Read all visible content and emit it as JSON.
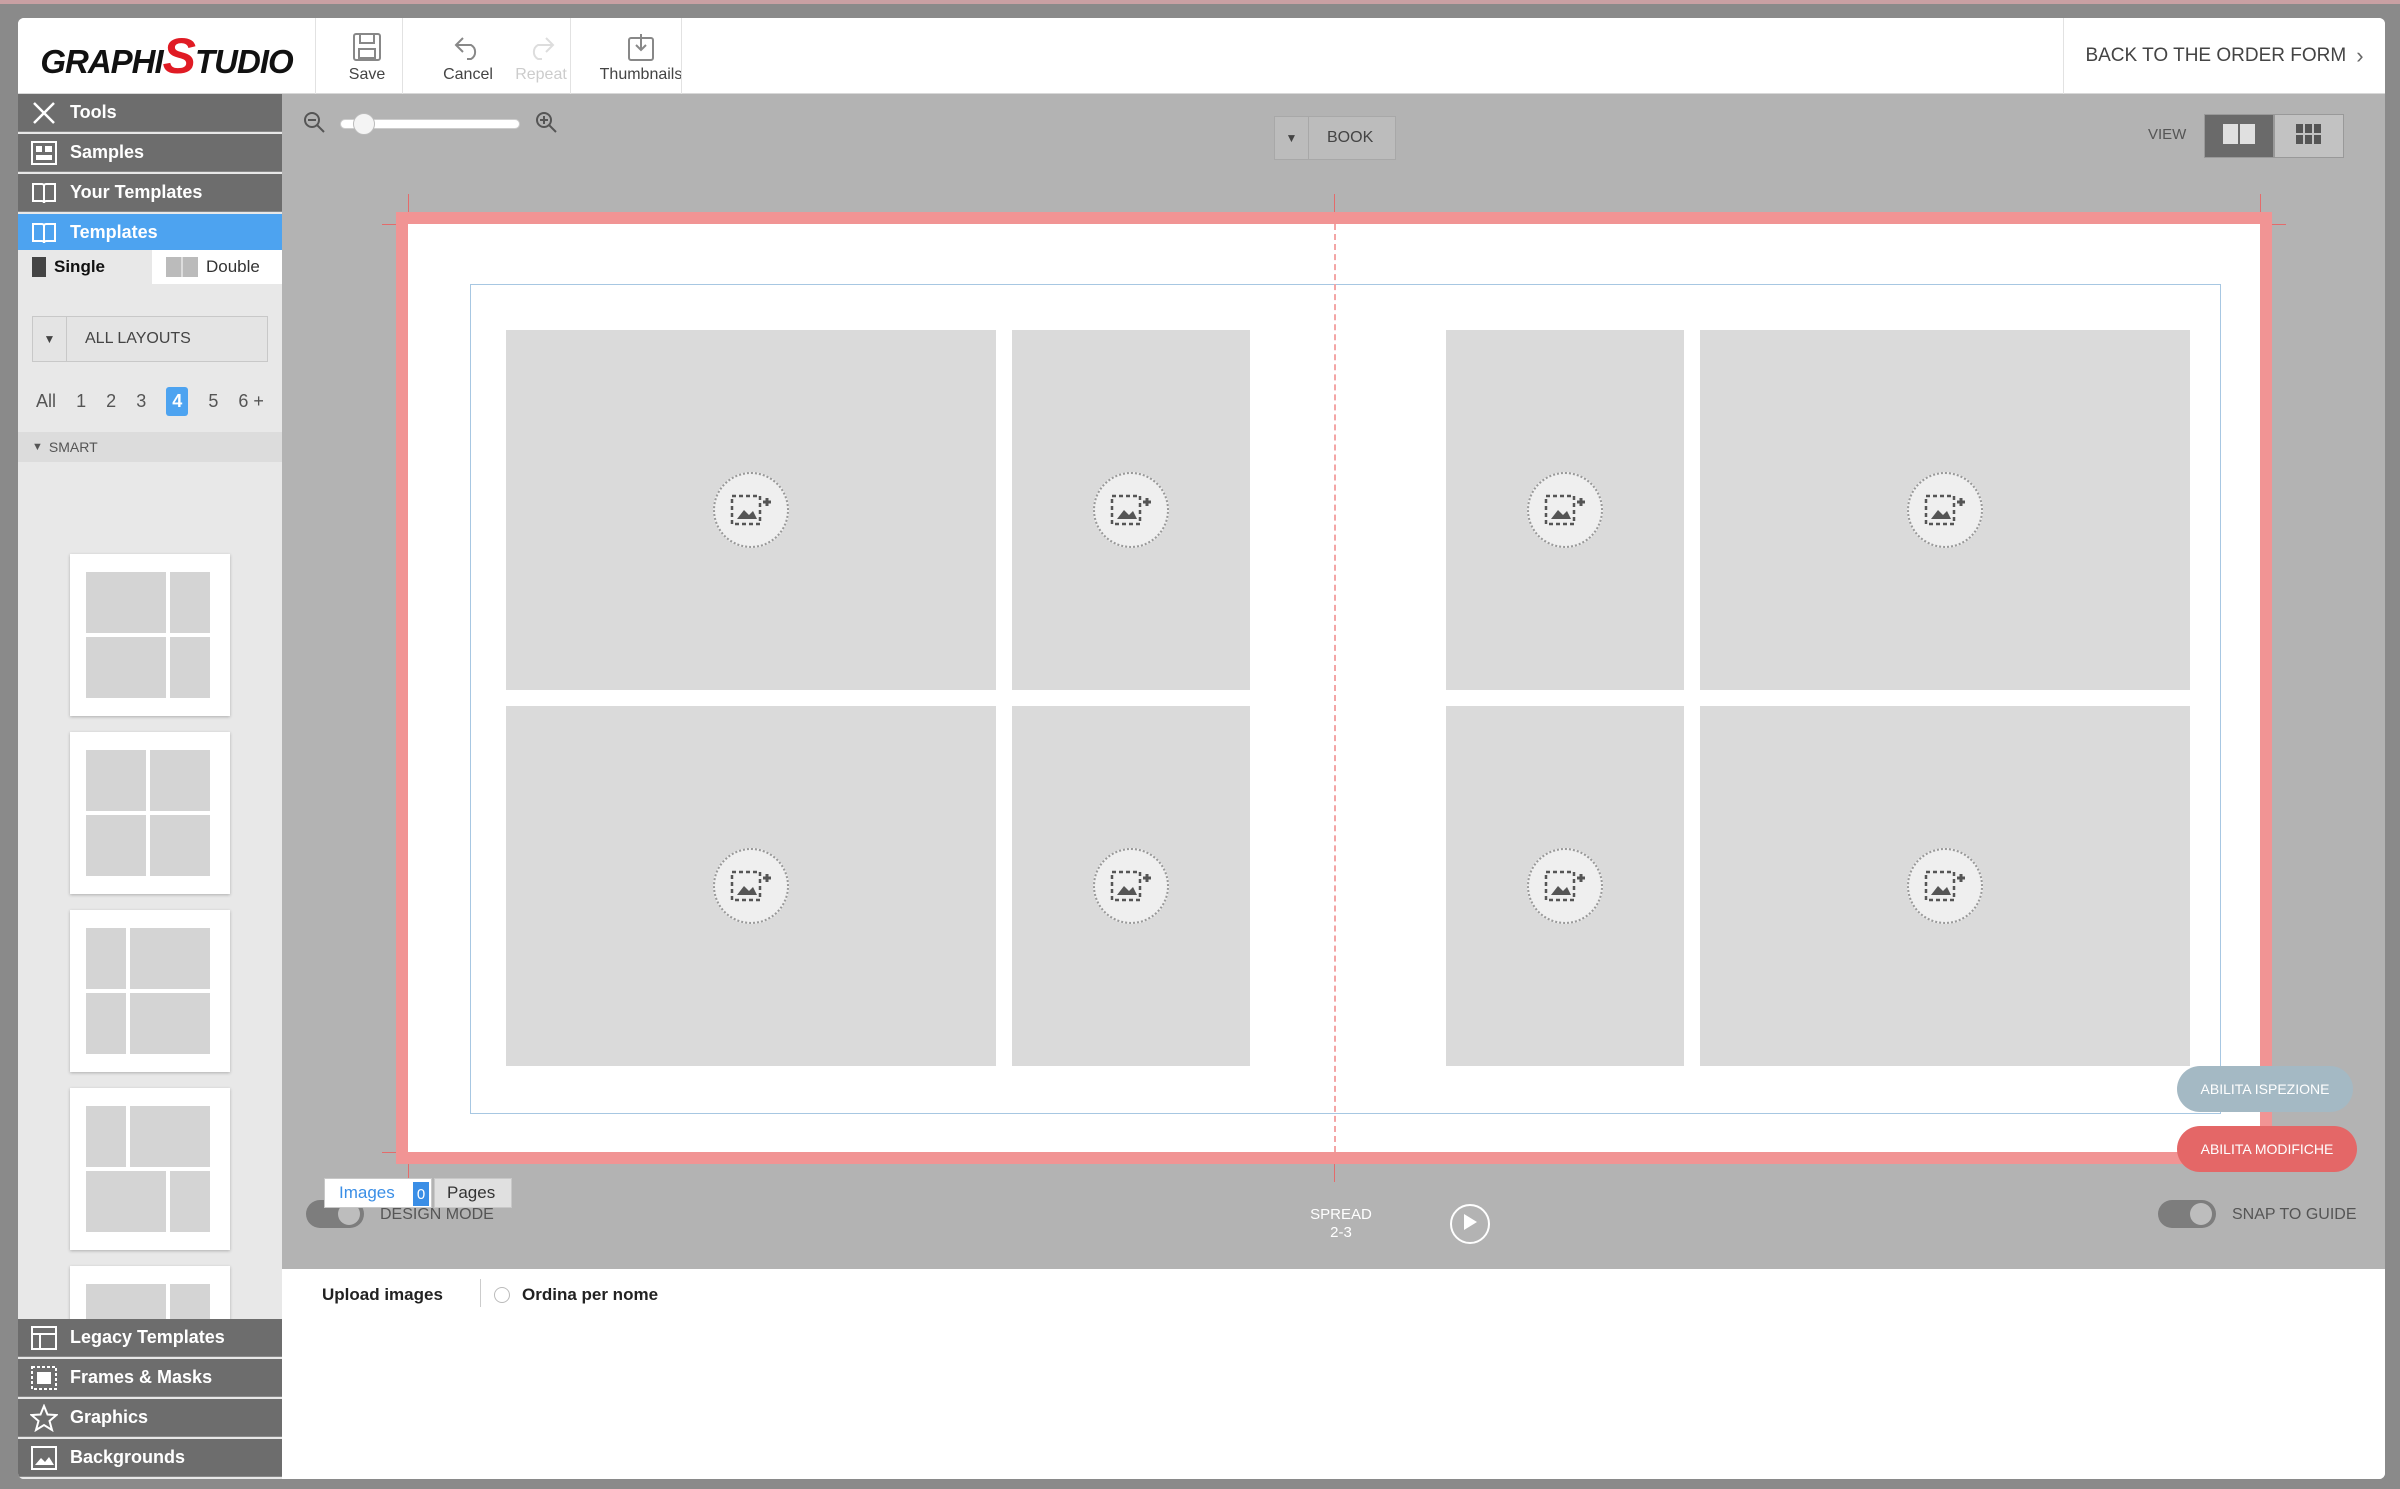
{
  "app": {
    "logo_text_pre": "GRAPHI",
    "logo_text_s": "S",
    "logo_text_post": "TUDIO",
    "brand_color": "#e01b24",
    "accent_color": "#4da3f0"
  },
  "toolbar": {
    "save": "Save",
    "cancel": "Cancel",
    "repeat": "Repeat",
    "thumbnails": "Thumbnails",
    "back": "BACK TO THE ORDER FORM"
  },
  "sidebar": {
    "categories_top": [
      {
        "label": "Tools",
        "icon": "tools-icon"
      },
      {
        "label": "Samples",
        "icon": "samples-icon"
      },
      {
        "label": "Your Templates",
        "icon": "book-icon"
      },
      {
        "label": "Templates",
        "icon": "book-icon",
        "active": true
      }
    ],
    "single": "Single",
    "double": "Double",
    "layout_filter": "ALL LAYOUTS",
    "page_filters": [
      "All",
      "1",
      "2",
      "3",
      "4",
      "5",
      "6 +"
    ],
    "selected_filter": "4",
    "section": "SMART",
    "categories_bottom": [
      {
        "label": "Legacy Templates",
        "icon": "legacy-templates-icon"
      },
      {
        "label": "Frames & Masks",
        "icon": "frames-icon"
      },
      {
        "label": "Graphics",
        "icon": "star-icon"
      },
      {
        "label": "Backgrounds",
        "icon": "background-icon"
      }
    ]
  },
  "canvas": {
    "zoom_level": 0.08,
    "book_mode": "BOOK",
    "view_label": "VIEW",
    "design_mode": "DESIGN MODE",
    "snap_to_guide": "SNAP TO GUIDE",
    "spread_label": "SPREAD",
    "spread_pages": "2-3",
    "enable_inspection": "ABILITA ISPEZIONE",
    "enable_edits": "ABILITA MODIFICHE"
  },
  "bottom": {
    "tab_images": "Images",
    "images_count": "0",
    "tab_pages": "Pages",
    "upload": "Upload images",
    "sort_by_name": "Ordina per nome"
  }
}
